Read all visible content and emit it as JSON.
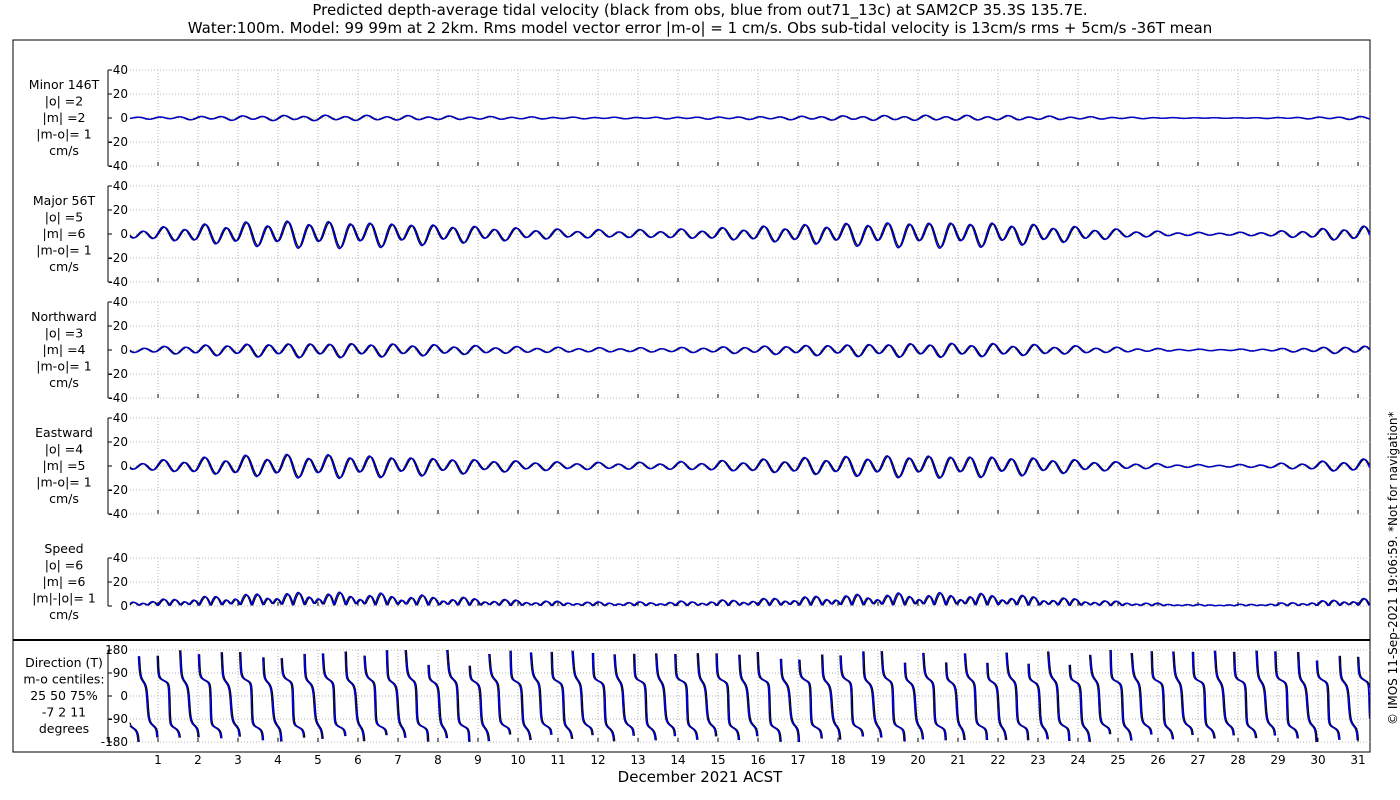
{
  "title": "Predicted depth-average tidal velocity (black from obs, blue from out71_13c) at SAM2CP 35.3S 135.7E.",
  "subtitle": "Water:100m. Model: 99 99m at 2 2km. Rms model vector error |m-o| = 1 cm/s. Obs sub-tidal velocity is 13cm/s rms + 5cm/s -36T mean",
  "xlabel": "December 2021 ACST",
  "credit": "© IMOS 11-Sep-2021 19:06:59. *Not for navigation*",
  "colors": {
    "obs": "#000000",
    "model": "#0000cc",
    "grid": "#b4b4b4"
  },
  "chart_data": {
    "type": "line",
    "series_labels": [
      "black from obs",
      "blue from out71_13c"
    ],
    "x": {
      "ticks": [
        1,
        2,
        3,
        4,
        5,
        6,
        7,
        8,
        9,
        10,
        11,
        12,
        13,
        14,
        15,
        16,
        17,
        18,
        19,
        20,
        21,
        22,
        23,
        24,
        25,
        26,
        27,
        28,
        29,
        30,
        31
      ],
      "range": [
        0.3,
        31.3
      ],
      "label": "December 2021 ACST"
    },
    "panels": [
      {
        "id": "minor",
        "label_lines": [
          "Minor 146T",
          "|o| =2",
          "|m| =2",
          "|m-o|= 1",
          "cm/s"
        ],
        "ylim": [
          -40,
          40
        ],
        "yticks": [
          -40,
          -20,
          0,
          20,
          40
        ],
        "amplitude": 2.2,
        "component": "minor"
      },
      {
        "id": "major",
        "label_lines": [
          "Major 56T",
          "|o| =5",
          "|m| =6",
          "|m-o|= 1",
          "cm/s"
        ],
        "ylim": [
          -40,
          40
        ],
        "yticks": [
          -40,
          -20,
          0,
          20,
          40
        ],
        "amplitude": 9,
        "component": "major"
      },
      {
        "id": "northward",
        "label_lines": [
          "Northward",
          "|o| =3",
          "|m| =4",
          "|m-o|= 1",
          "cm/s"
        ],
        "ylim": [
          -40,
          40
        ],
        "yticks": [
          -40,
          -20,
          0,
          20,
          40
        ],
        "amplitude": 6,
        "component": "north"
      },
      {
        "id": "eastward",
        "label_lines": [
          "Eastward",
          "|o| =4",
          "|m| =5",
          "|m-o|= 1",
          "cm/s"
        ],
        "ylim": [
          -40,
          40
        ],
        "yticks": [
          -40,
          -20,
          0,
          20,
          40
        ],
        "amplitude": 7,
        "component": "east"
      },
      {
        "id": "speed",
        "label_lines": [
          "Speed",
          "|o| =6",
          "|m| =6",
          "|m|-|o|= 1",
          "cm/s"
        ],
        "ylim": [
          0,
          40
        ],
        "yticks": [
          0,
          20,
          40
        ],
        "amplitude": 9,
        "component": "speed"
      },
      {
        "id": "direction",
        "label_lines": [
          "Direction (T)",
          "m-o centiles:",
          "25  50  75%",
          "-7   2  11",
          "degrees"
        ],
        "ylim": [
          -180,
          180
        ],
        "yticks": [
          -180,
          -90,
          0,
          90,
          180
        ],
        "component": "direction"
      }
    ],
    "direction_centiles": {
      "percent": [
        25,
        50,
        75
      ],
      "degrees": [
        -7,
        2,
        11
      ]
    },
    "summary": {
      "water_depth_m": 100,
      "rms_vector_error_cm_s": 1,
      "subtidal_rms_cm_s": 13,
      "subtidal_mean_cm_s": 5,
      "subtidal_mean_dir_T": -36
    }
  }
}
